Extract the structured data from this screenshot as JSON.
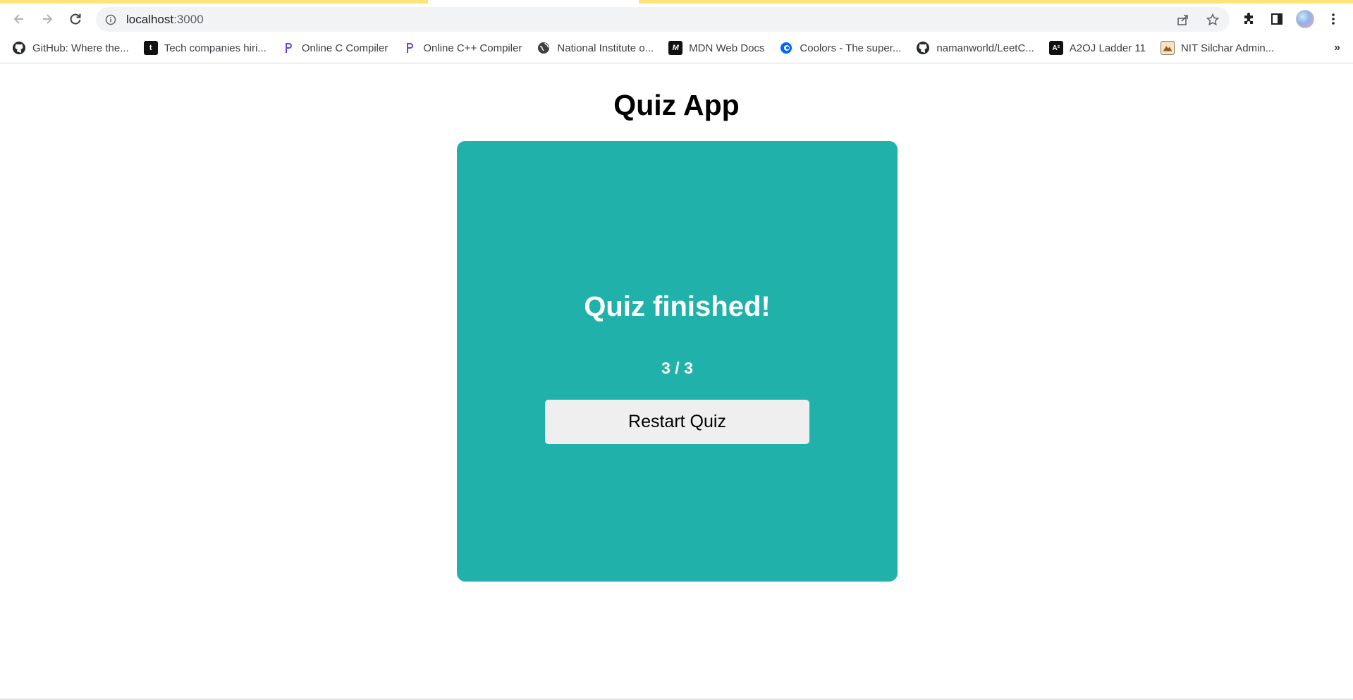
{
  "browser": {
    "url_host": "localhost",
    "url_port": ":3000",
    "bookmarks": [
      {
        "label": "GitHub: Where the...",
        "icon": "github-icon"
      },
      {
        "label": "Tech companies hiri...",
        "icon": "t-icon"
      },
      {
        "label": "Online C Compiler",
        "icon": "programiz-icon"
      },
      {
        "label": "Online C++ Compiler",
        "icon": "programiz-icon"
      },
      {
        "label": "National Institute o...",
        "icon": "globe-icon"
      },
      {
        "label": "MDN Web Docs",
        "icon": "mdn-icon"
      },
      {
        "label": "Coolors - The super...",
        "icon": "coolors-icon"
      },
      {
        "label": "namanworld/LeetC...",
        "icon": "github-icon"
      },
      {
        "label": "A2OJ Ladder 11",
        "icon": "a2oj-icon"
      },
      {
        "label": "NIT Silchar Admin...",
        "icon": "nit-icon"
      }
    ],
    "more_label": "»"
  },
  "app": {
    "title": "Quiz App",
    "finished_text": "Quiz finished!",
    "score_text": "3 / 3",
    "restart_label": "Restart Quiz"
  },
  "colors": {
    "card_bg": "#20b2aa",
    "button_bg": "#efefef",
    "tab_accent": "#fde37a"
  }
}
